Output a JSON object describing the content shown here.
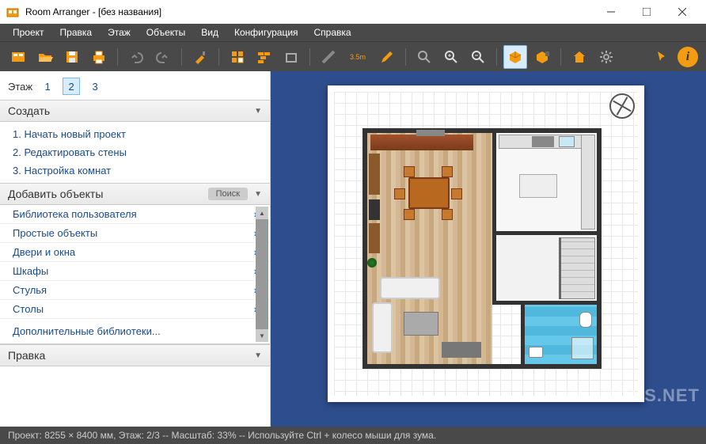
{
  "titlebar": {
    "title": "Room Arranger - [без названия]"
  },
  "menu": [
    "Проект",
    "Правка",
    "Этаж",
    "Объекты",
    "Вид",
    "Конфигурация",
    "Справка"
  ],
  "toolbar": {
    "dim_label": "3.5m"
  },
  "sidebar": {
    "floor_label": "Этаж",
    "floors": [
      "1",
      "2",
      "3"
    ],
    "active_floor": 1,
    "create_header": "Создать",
    "create_items": [
      "1. Начать новый проект",
      "2. Редактировать стены",
      "3. Настройка комнат"
    ],
    "objects_header": "Добавить объекты",
    "search_label": "Поиск",
    "object_categories": [
      "Библиотека пользователя",
      "Простые объекты",
      "Двери и окна",
      "Шкафы",
      "Стулья",
      "Столы"
    ],
    "extra_libs": "Дополнительные библиотеки...",
    "edit_header": "Правка"
  },
  "statusbar": {
    "text": "Проект: 8255 × 8400 мм, Этаж: 2/3 -- Масштаб: 33% -- Используйте Ctrl + колесо мыши для зума."
  },
  "watermark": "PCPROGS.NET"
}
